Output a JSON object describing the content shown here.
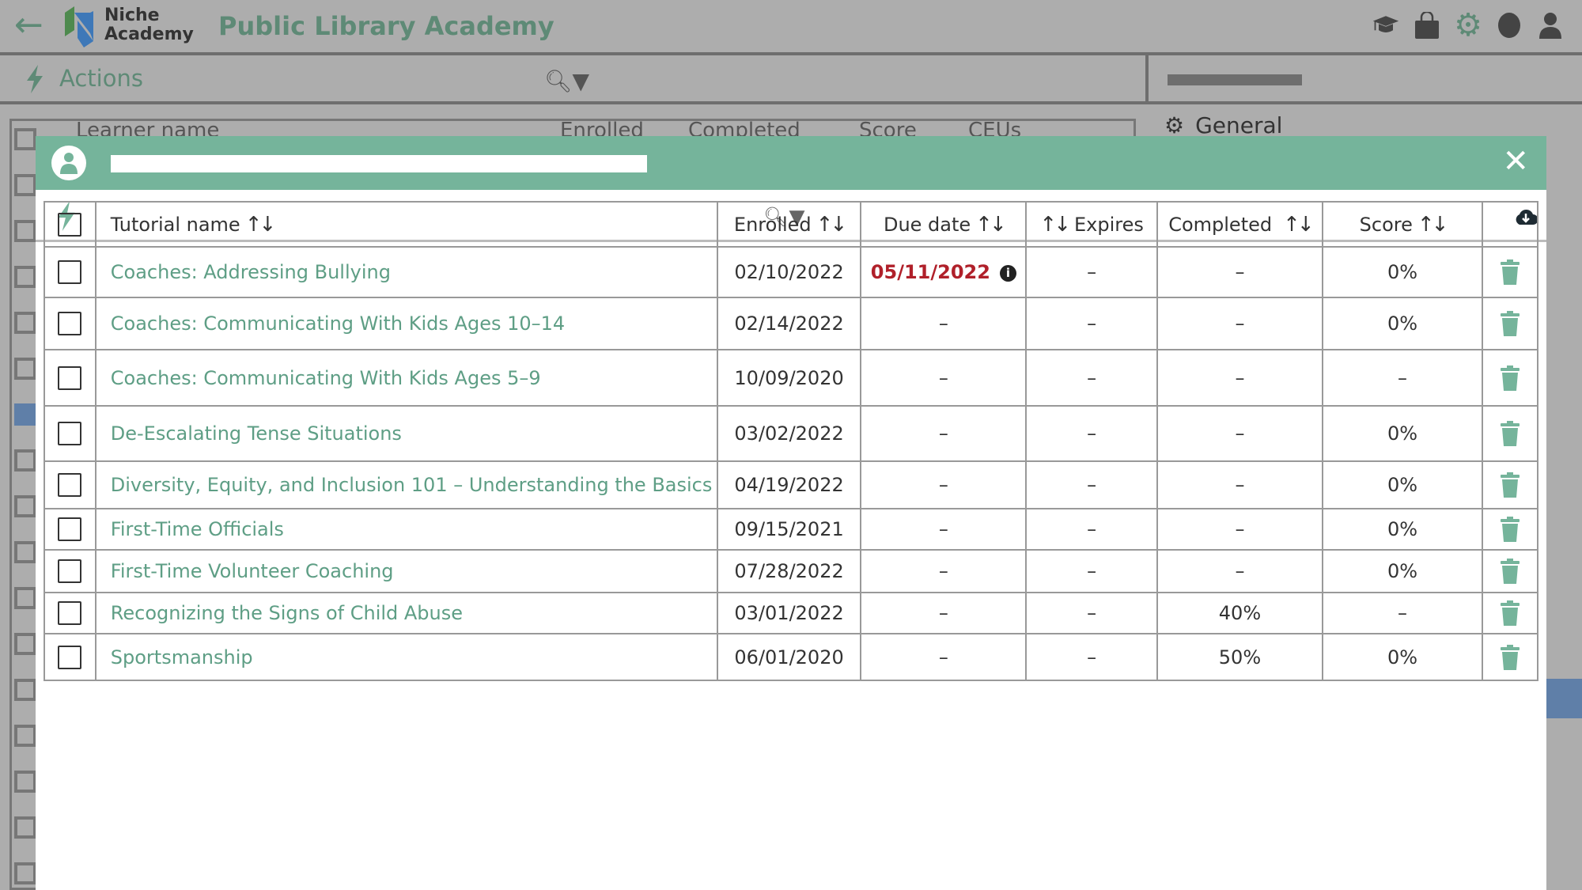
{
  "app": {
    "back_icon": "arrow-left-icon",
    "logo_text_line1": "Niche",
    "logo_text_line2": "Academy",
    "title": "Public Library Academy",
    "top_icons": [
      "graduation-cap-icon",
      "shopping-bag-icon",
      "gear-icon",
      "circle-icon",
      "user-icon"
    ],
    "accent": "#75b49b"
  },
  "actions": {
    "label": "Actions"
  },
  "right_panel": {
    "general_label": "General"
  },
  "background_table": {
    "headers": [
      "Learner name",
      "Enrolled",
      "Completed",
      "Score",
      "CEUs"
    ]
  },
  "modal": {
    "columns": [
      "Tutorial name",
      "Enrolled",
      "Due date",
      "Expires",
      "Completed",
      "Score"
    ],
    "rows": [
      {
        "name": "Coaches: Addressing Bullying",
        "enrolled": "02/10/2022",
        "due": "05/11/2022",
        "due_overdue": true,
        "expires": "–",
        "completed": "–",
        "score": "0%"
      },
      {
        "name": "Coaches: Communicating With Kids Ages 10–14",
        "enrolled": "02/14/2022",
        "due": "–",
        "expires": "–",
        "completed": "–",
        "score": "0%"
      },
      {
        "name": "Coaches: Communicating With Kids Ages 5–9",
        "enrolled": "10/09/2020",
        "due": "–",
        "expires": "–",
        "completed": "–",
        "score": "–"
      },
      {
        "name": "De-Escalating Tense Situations",
        "enrolled": "03/02/2022",
        "due": "–",
        "expires": "–",
        "completed": "–",
        "score": "0%"
      },
      {
        "name": "Diversity, Equity, and Inclusion 101 – Understanding the Basics",
        "enrolled": "04/19/2022",
        "due": "–",
        "expires": "–",
        "completed": "–",
        "score": "0%"
      },
      {
        "name": "First-Time Officials",
        "enrolled": "09/15/2021",
        "due": "–",
        "expires": "–",
        "completed": "–",
        "score": "0%"
      },
      {
        "name": "First-Time Volunteer Coaching",
        "enrolled": "07/28/2022",
        "due": "–",
        "expires": "–",
        "completed": "–",
        "score": "0%"
      },
      {
        "name": "Recognizing the Signs of Child Abuse",
        "enrolled": "03/01/2022",
        "due": "–",
        "expires": "–",
        "completed": "40%",
        "score": "–"
      },
      {
        "name": "Sportsmanship",
        "enrolled": "06/01/2020",
        "due": "–",
        "expires": "–",
        "completed": "50%",
        "score": "0%"
      }
    ],
    "overdue_color": "#b0202a"
  }
}
